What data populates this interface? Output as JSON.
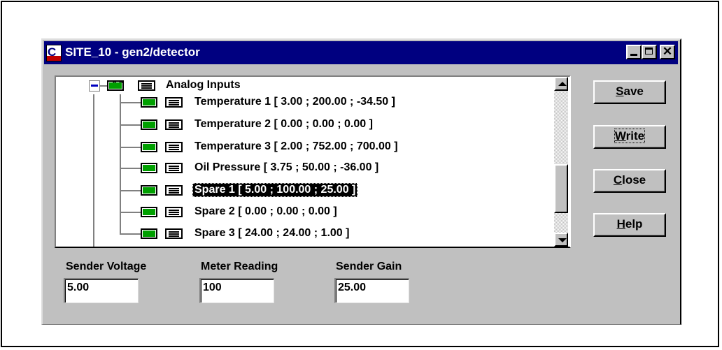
{
  "window": {
    "title": "SITE_10 - gen2/detector",
    "controls": {
      "minimize_icon": "minimize-icon",
      "maximize_icon": "maximize-icon",
      "close_glyph": "✕"
    }
  },
  "tree": {
    "root": {
      "label": "Analog Inputs",
      "expanded": true
    },
    "items": [
      {
        "label": "Temperature 1  [ 3.00 ; 200.00 ; -34.50 ]",
        "selected": false
      },
      {
        "label": "Temperature 2  [ 0.00 ; 0.00 ; 0.00 ]",
        "selected": false
      },
      {
        "label": "Temperature 3  [ 2.00 ; 752.00 ; 700.00 ]",
        "selected": false
      },
      {
        "label": "Oil Pressure  [ 3.75 ; 50.00 ; -36.00 ]",
        "selected": false
      },
      {
        "label": "Spare 1  [ 5.00 ; 100.00 ; 25.00 ]",
        "selected": true
      },
      {
        "label": "Spare 2  [ 0.00 ; 0.00 ; 0.00 ]",
        "selected": false
      },
      {
        "label": "Spare 3  [ 24.00 ; 24.00 ; 1.00 ]",
        "selected": false
      }
    ]
  },
  "buttons": {
    "save": {
      "mnemonic": "S",
      "rest": "ave"
    },
    "write": {
      "mnemonic": "W",
      "rest": "rite"
    },
    "close": {
      "mnemonic": "C",
      "rest": "lose"
    },
    "help": {
      "mnemonic": "H",
      "rest": "elp"
    }
  },
  "fields": {
    "sender_voltage": {
      "label": "Sender Voltage",
      "value": "5.00"
    },
    "meter_reading": {
      "label": "Meter Reading",
      "value": "100"
    },
    "sender_gain": {
      "label": "Sender Gain",
      "value": "25.00"
    }
  },
  "colors": {
    "titlebar": "#000080",
    "face": "#c0c0c0",
    "selection": "#000000",
    "sensor_icon": "#00a000",
    "collapse_minus": "#0000c0"
  }
}
